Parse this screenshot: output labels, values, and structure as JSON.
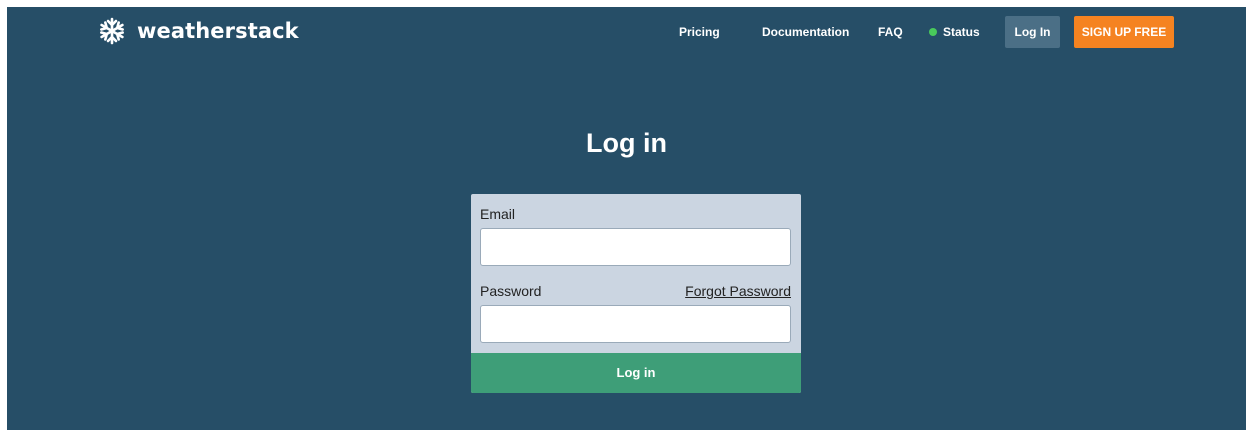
{
  "brand": {
    "name": "weatherstack",
    "logo_icon": "snowflake-icon"
  },
  "nav": {
    "pricing": "Pricing",
    "documentation": "Documentation",
    "faq": "FAQ",
    "status": "Status",
    "login": "Log In",
    "signup": "SIGN UP FREE"
  },
  "page": {
    "title": "Log in"
  },
  "form": {
    "email_label": "Email",
    "email_value": "",
    "password_label": "Password",
    "password_value": "",
    "forgot_password": "Forgot Password",
    "submit_label": "Log in"
  },
  "colors": {
    "background": "#264e67",
    "signup_accent": "#f58321",
    "login_nav_button": "#4b6f86",
    "submit_button": "#3e9e78",
    "form_panel": "#cbd5e1",
    "status_ok": "#49c95b"
  }
}
